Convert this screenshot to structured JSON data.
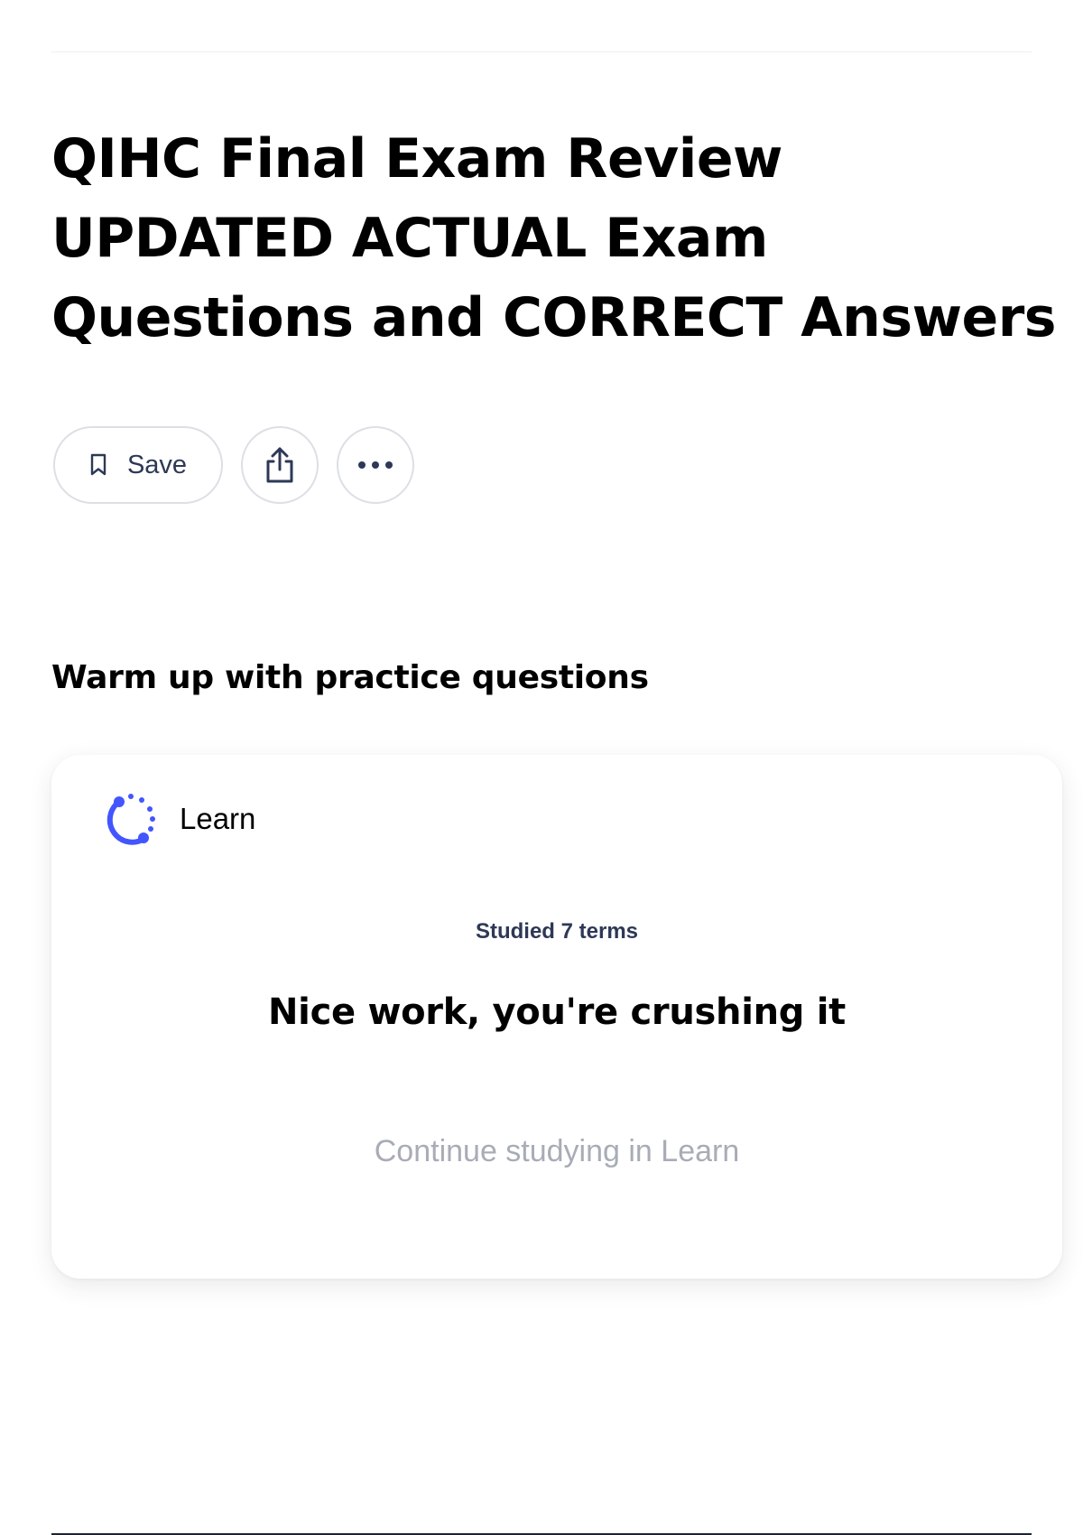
{
  "page": {
    "title": "QIHC Final Exam Review UPDATED ACTUAL Exam Questions and CORRECT Answers"
  },
  "actions": {
    "save_label": "Save",
    "save_icon": "bookmark-icon",
    "share_icon": "share-icon",
    "more_icon": "more-options-icon"
  },
  "section": {
    "heading": "Warm up with practice questions"
  },
  "learn_card": {
    "title": "Learn",
    "icon": "learn-progress-icon",
    "studied_text": "Studied 7 terms",
    "encouragement": "Nice work, you're crushing it",
    "continue_label": "Continue studying in Learn"
  },
  "colors": {
    "accent": "#4255ff",
    "text_primary": "#000000",
    "text_secondary": "#2e3856",
    "muted": "#a8acb6",
    "border": "#dcdfe6"
  }
}
